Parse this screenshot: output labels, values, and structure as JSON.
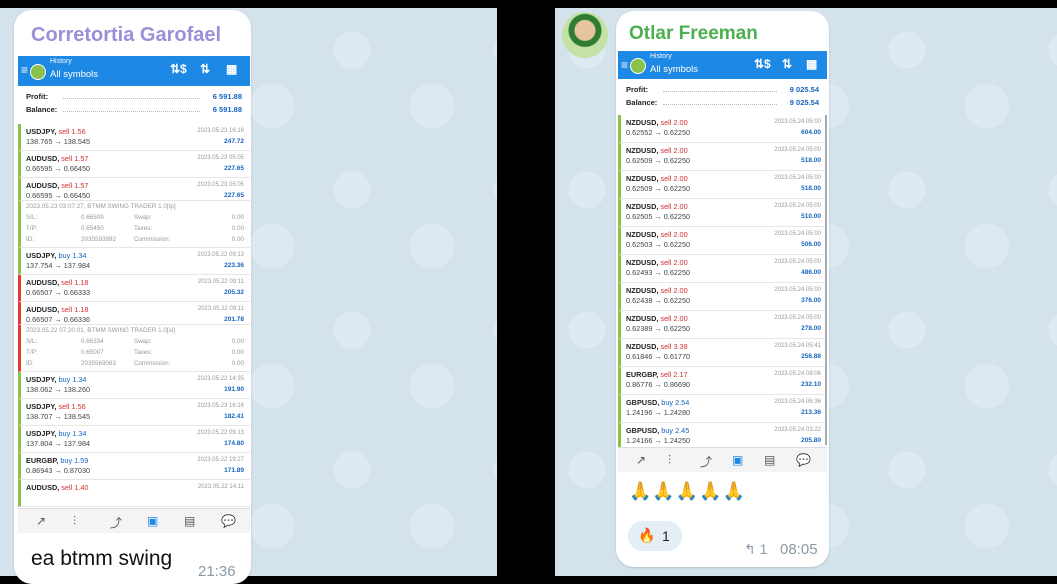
{
  "left": {
    "sender": "Corretortia Garofael",
    "app": {
      "small_title": "History",
      "title": "All symbols",
      "icons": [
        "swap-icon",
        "sort-icon",
        "calendar-icon"
      ]
    },
    "summary": [
      {
        "k": "Profit:",
        "v": "6 591.88"
      },
      {
        "k": "Balance:",
        "v": "6 591.88"
      }
    ],
    "trades": [
      {
        "sym": "USDJPY,",
        "side": "sell 1.56",
        "px": "138.765 → 138.545",
        "dt": "2023.05.23 16:16",
        "pl": "247.72"
      },
      {
        "sym": "AUDUSD,",
        "side": "sell 1.57",
        "px": "0.66595 → 0.66450",
        "dt": "2023.05.23 05:05",
        "pl": "227.65"
      },
      {
        "sym": "AUDUSD,",
        "side": "sell 1.57",
        "px": "0.66595 → 0.66450",
        "dt": "2023.05.23 05:05",
        "pl": "227.65"
      }
    ],
    "detail1": {
      "head": "2023.05.23 03:07:27, BTMM SWING TRADER 1.0[tp]",
      "sl": "0.66509",
      "tp": "0.65450",
      "id": "2035593992",
      "swap": "0.00",
      "taxes": "0.00",
      "comm": "0.00",
      "l_sl": "S/L:",
      "l_tp": "T/P:",
      "l_id": "ID:",
      "l_swap": "Swap:",
      "l_taxes": "Taxes:",
      "l_comm": "Commission:"
    },
    "trades2": [
      {
        "sym": "USDJPY,",
        "side": "buy 1.34",
        "px": "137.754 → 137.984",
        "dt": "2023.05.22 09:13",
        "pl": "223.36",
        "buy": true
      },
      {
        "sym": "AUDUSD,",
        "side": "sell 1.18",
        "px": "0.66507 → 0.66333",
        "dt": "2023.05.22 09:11",
        "pl": "205.32",
        "red": true
      },
      {
        "sym": "AUDUSD,",
        "side": "sell 1.18",
        "px": "0.66507 → 0.66336",
        "dt": "2023.05.22 09:11",
        "pl": "201.78",
        "red": true
      }
    ],
    "detail2": {
      "head": "2023.05.22 07:20:01, BTMM SWING TRADER 1.0[sl]",
      "sl": "0.66334",
      "tp": "0.65007",
      "id": "2035569063",
      "swap": "0.00",
      "taxes": "0.00",
      "comm": "0.00",
      "l_sl": "S/L:",
      "l_tp": "T/P:",
      "l_id": "ID:",
      "l_swap": "Swap:",
      "l_taxes": "Taxes:",
      "l_comm": "Commission:"
    },
    "trades3": [
      {
        "sym": "USDJPY,",
        "side": "buy 1.34",
        "px": "138.062 → 138.260",
        "dt": "2023.05.22 14:35",
        "pl": "191.90",
        "buy": true
      },
      {
        "sym": "USDJPY,",
        "side": "sell 1.56",
        "px": "138.707 → 138.545",
        "dt": "2023.05.23 16:16",
        "pl": "182.41"
      },
      {
        "sym": "USDJPY,",
        "side": "buy 1.34",
        "px": "137.804 → 137.984",
        "dt": "2023.05.22 09.13",
        "pl": "174.80",
        "buy": true
      },
      {
        "sym": "EURGBP,",
        "side": "buy 1.59",
        "px": "0.86943 → 0.87030",
        "dt": "2023.05.22 19:27",
        "pl": "171.89",
        "buy": true
      },
      {
        "sym": "AUDUSD,",
        "side": "sell 1.40",
        "px": "",
        "dt": "2023.05.22 14:11",
        "pl": ""
      }
    ],
    "caption": "ea btmm swing",
    "time": "21:36"
  },
  "right": {
    "sender": "Otlar Freeman",
    "app": {
      "small_title": "History",
      "title": "All symbols"
    },
    "summary": [
      {
        "k": "Profit:",
        "v": "9 025.54"
      },
      {
        "k": "Balance:",
        "v": "9 025.54"
      }
    ],
    "trades": [
      {
        "sym": "NZDUSD,",
        "side": "sell 2.00",
        "px": "0.62552 → 0.62250",
        "dt": "2023.05.24 05:00",
        "pl": "604.00"
      },
      {
        "sym": "NZDUSD,",
        "side": "sell 2.00",
        "px": "0.62509 → 0.62250",
        "dt": "2023.05.24 05:00",
        "pl": "518.00"
      },
      {
        "sym": "NZDUSD,",
        "side": "sell 2.00",
        "px": "0.62509 → 0.62250",
        "dt": "2023.05.24 05:00",
        "pl": "518.00"
      },
      {
        "sym": "NZDUSD,",
        "side": "sell 2.00",
        "px": "0.62505 → 0.62250",
        "dt": "2023.05.24 05:00",
        "pl": "510.00"
      },
      {
        "sym": "NZDUSD,",
        "side": "sell 2.00",
        "px": "0.62503 → 0.62250",
        "dt": "2023.05.24 05:00",
        "pl": "506.00"
      },
      {
        "sym": "NZDUSD,",
        "side": "sell 2.00",
        "px": "0.62493 → 0.62250",
        "dt": "2023.05.24 05:00",
        "pl": "486.00"
      },
      {
        "sym": "NZDUSD,",
        "side": "sell 2.00",
        "px": "0.62438 → 0.62250",
        "dt": "2023.05.24 05:00",
        "pl": "376.00"
      },
      {
        "sym": "NZDUSD,",
        "side": "sell 2.00",
        "px": "0.62389 → 0.62250",
        "dt": "2023.05.24 05:00",
        "pl": "278.00"
      },
      {
        "sym": "NZDUSD,",
        "side": "sell 3.38",
        "px": "0.61846 → 0.61770",
        "dt": "2023.05.24 05:41",
        "pl": "256.88"
      },
      {
        "sym": "EURGBP,",
        "side": "sell 2.17",
        "px": "0.86776 → 0.86690",
        "dt": "2023.05.24 08:06",
        "pl": "232.10"
      },
      {
        "sym": "GBPUSD,",
        "side": "buy 2.54",
        "px": "1.24196 → 1.24280",
        "dt": "2023.05.24 06:36",
        "pl": "213.36",
        "buy": true
      },
      {
        "sym": "GBPUSD,",
        "side": "buy 2.45",
        "px": "1.24166 → 1.24250",
        "dt": "2023.05.24 03:22",
        "pl": "205.80",
        "buy": true
      }
    ],
    "emojis": "🙏🙏🙏🙏🙏",
    "reaction": {
      "emoji": "🔥",
      "count": "1"
    },
    "replies": {
      "arrow": "↰",
      "count": "1"
    },
    "time": "08:05"
  },
  "nav_icons": [
    "↗",
    "⫶",
    "⤴",
    "▣",
    "▤",
    "💬"
  ],
  "colors": {
    "accent": "#1e88e5",
    "profit": "#1565c0",
    "sell": "#d32f2f",
    "bar_green": "#8bc34a",
    "bar_red": "#e53935",
    "chat_bg": "#d4e2ec",
    "sender_left": "#9c8fd6",
    "sender_right": "#4caf50"
  }
}
